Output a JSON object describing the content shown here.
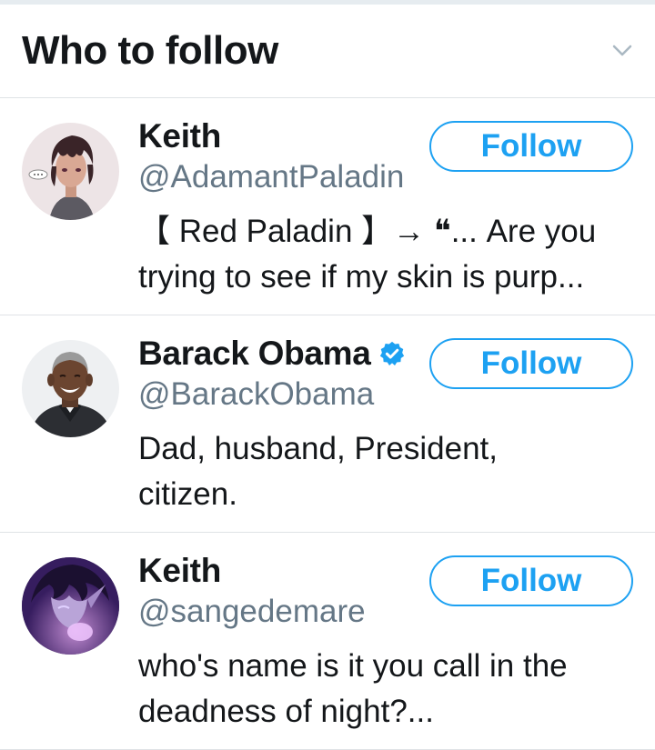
{
  "header": {
    "title": "Who to follow",
    "collapse_icon": "chevron-down-icon"
  },
  "accounts": [
    {
      "name": "Keith",
      "handle": "@AdamantPaladin",
      "verified": false,
      "bio_line1": "【 Red Paladin 】→ ❝... Are you",
      "bio_line2": "trying to see if my skin is purp...",
      "follow_label": "Follow",
      "avatar_icon": "anime-avatar-icon"
    },
    {
      "name": "Barack Obama",
      "handle": "@BarackObama",
      "verified": true,
      "bio_line1": "Dad, husband, President,",
      "bio_line2": "citizen.",
      "follow_label": "Follow",
      "avatar_icon": "portrait-avatar-icon"
    },
    {
      "name": "Keith",
      "handle": "@sangedemare",
      "verified": false,
      "bio_line1": "who's name is it you call in the",
      "bio_line2": "deadness of night?...",
      "follow_label": "Follow",
      "avatar_icon": "purple-anime-avatar-icon"
    }
  ],
  "colors": {
    "accent": "#1da1f2",
    "handle_gray": "#657786",
    "divider": "#dfe3e6",
    "text": "#14171a"
  }
}
